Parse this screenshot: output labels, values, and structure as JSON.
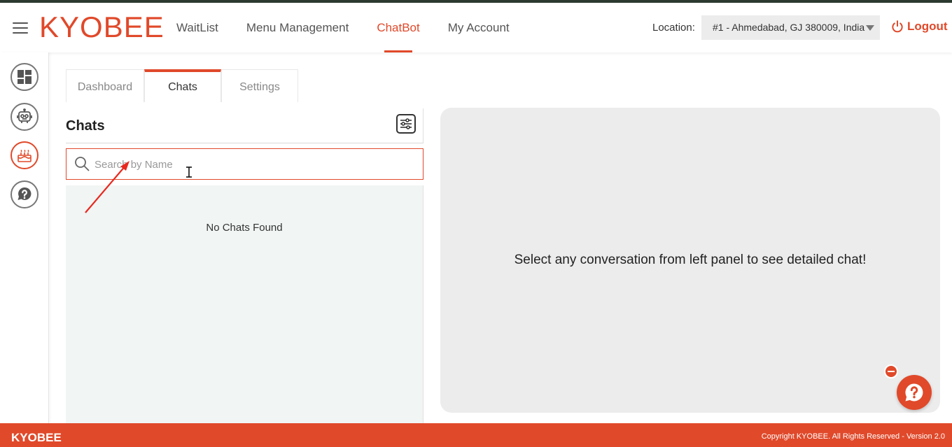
{
  "header": {
    "logo": "KYOBEE",
    "nav": [
      {
        "label": "WaitList",
        "active": false
      },
      {
        "label": "Menu Management",
        "active": false
      },
      {
        "label": "ChatBot",
        "active": true
      },
      {
        "label": "My Account",
        "active": false
      }
    ],
    "location_label": "Location:",
    "location_value": "#1 - Ahmedabad, GJ 380009, India",
    "logout_label": "Logout"
  },
  "sidebar": {
    "items": [
      {
        "icon": "dashboard-icon"
      },
      {
        "icon": "robot-icon"
      },
      {
        "icon": "cake-icon",
        "active": true
      },
      {
        "icon": "help-icon"
      }
    ]
  },
  "tabs": [
    {
      "label": "Dashboard",
      "active": false
    },
    {
      "label": "Chats",
      "active": true
    },
    {
      "label": "Settings",
      "active": false
    }
  ],
  "chats": {
    "title": "Chats",
    "search_placeholder": "Search by Name",
    "search_value": "",
    "empty_text": "No Chats Found"
  },
  "detail": {
    "message": "Select any conversation from left panel to see detailed chat!"
  },
  "footer": {
    "brand": "KYOBEE",
    "copyright": "Copyright KYOBEE. All Rights Reserved - Version 2.0"
  },
  "colors": {
    "accent": "#e0492a",
    "list_bg": "#f1f5f4",
    "detail_bg": "#ececec"
  }
}
